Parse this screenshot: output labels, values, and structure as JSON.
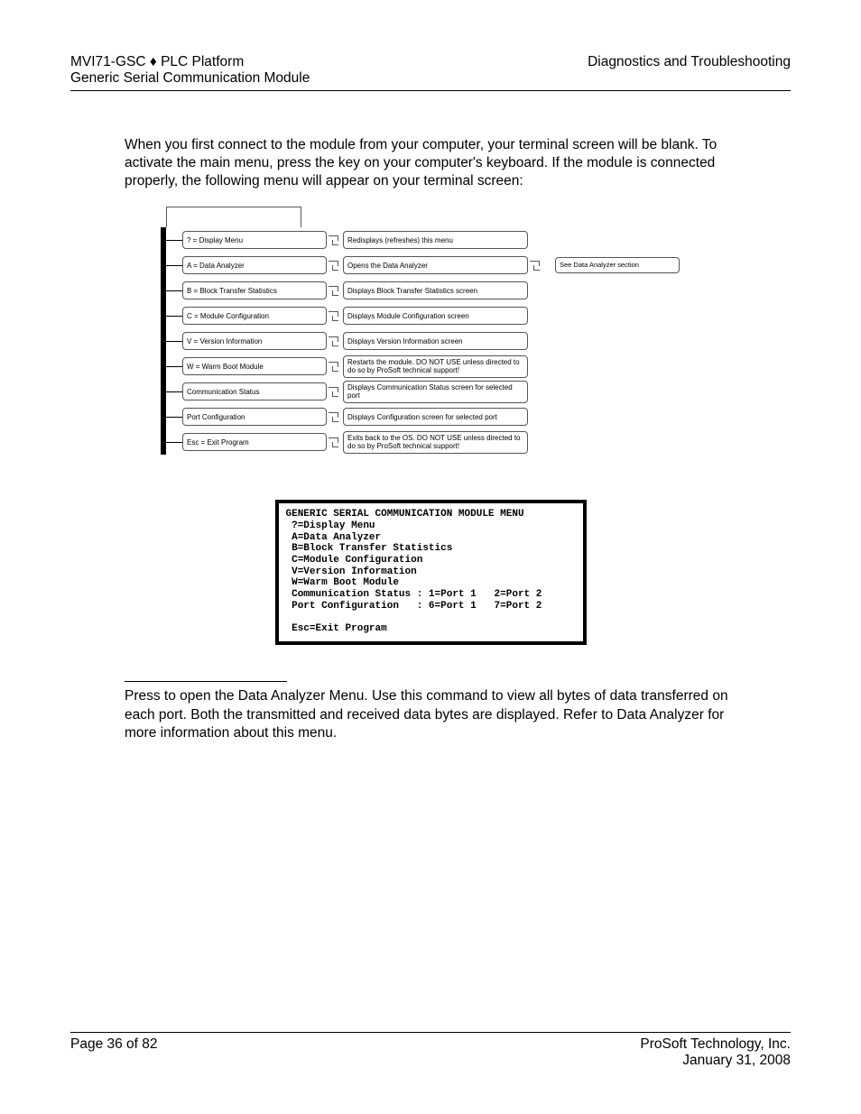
{
  "header": {
    "left_line1": "MVI71-GSC ♦ PLC Platform",
    "left_line2": "Generic Serial Communication Module",
    "right_line1": "Diagnostics and Troubleshooting"
  },
  "para1": "When you first connect to the module from your computer, your terminal screen will be blank. To activate the main menu, press the      key on your computer's keyboard. If the module is connected properly, the following menu will appear on your terminal screen:",
  "diagram": {
    "rows": [
      {
        "left": "? = Display Menu",
        "right": "Redisplays (refreshes) this menu",
        "far": ""
      },
      {
        "left": "A = Data Analyzer",
        "right": "Opens the Data Analyzer",
        "far": "See Data Analyzer section"
      },
      {
        "left": "B = Block Transfer Statistics",
        "right": "Displays Block Transfer Statistics screen",
        "far": ""
      },
      {
        "left": "C = Module Configuration",
        "right": "Displays Module Configuration screen",
        "far": ""
      },
      {
        "left": "V = Version Information",
        "right": "Displays Version Information screen",
        "far": ""
      },
      {
        "left": "W = Warm Boot Module",
        "right": "Restarts the module. DO NOT USE unless directed to do so by ProSoft technical support!",
        "far": ""
      },
      {
        "left": "Communication Status",
        "right": "Displays Communication Status screen for selected port",
        "far": ""
      },
      {
        "left": "Port Configuration",
        "right": "Displays Configuration screen for selected port",
        "far": ""
      },
      {
        "left": "Esc = Exit Program",
        "right": "Exits back to the OS. DO NOT USE unless directed to do so by ProSoft technical support!",
        "far": ""
      }
    ]
  },
  "terminal_lines": [
    "GENERIC SERIAL COMMUNICATION MODULE MENU",
    " ?=Display Menu",
    " A=Data Analyzer",
    " B=Block Transfer Statistics",
    " C=Module Configuration",
    " V=Version Information",
    " W=Warm Boot Module",
    " Communication Status : 1=Port 1   2=Port 2",
    " Port Configuration   : 6=Port 1   7=Port 2",
    "",
    " Esc=Exit Program"
  ],
  "para2": "Press       to open the Data Analyzer Menu. Use this command to view all bytes of data transferred on each port. Both the transmitted and received data bytes are displayed. Refer to Data Analyzer for more information about this menu.",
  "footer": {
    "left": "Page 36 of 82",
    "right_line1": "ProSoft Technology, Inc.",
    "right_line2": "January 31, 2008"
  }
}
